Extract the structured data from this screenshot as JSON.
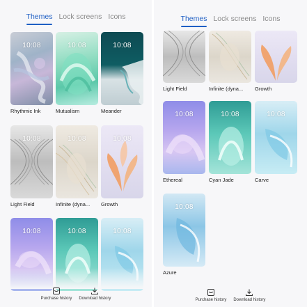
{
  "left": {
    "tabs": [
      {
        "label": "Themes",
        "active": true
      },
      {
        "label": "Lock screens",
        "active": false
      },
      {
        "label": "Icons",
        "active": false
      }
    ],
    "themes": [
      {
        "name": "Rhythmic Ink",
        "time": "10:08",
        "style": "wp-rhythmic"
      },
      {
        "name": "Mutualism",
        "time": "10:08",
        "style": "wp-mutualism"
      },
      {
        "name": "Meander",
        "time": "10:08",
        "style": "wp-meander"
      },
      {
        "name": "Light Field",
        "time": "10:08",
        "style": "wp-lightfield"
      },
      {
        "name": "Infinite (dyna...",
        "time": "10:08",
        "style": "wp-infinite"
      },
      {
        "name": "Growth",
        "time": "10:08",
        "style": "wp-growth"
      },
      {
        "name": "",
        "time": "10:08",
        "style": "wp-ethereal"
      },
      {
        "name": "",
        "time": "10:08",
        "style": "wp-cyanjade"
      },
      {
        "name": "",
        "time": "10:08",
        "style": "wp-carve"
      }
    ],
    "bottom": {
      "purchase_label": "Purchase history",
      "download_label": "Download history"
    }
  },
  "right": {
    "tabs": [
      {
        "label": "Themes",
        "active": true
      },
      {
        "label": "Lock screens",
        "active": false
      },
      {
        "label": "Icons",
        "active": false
      }
    ],
    "themes": [
      {
        "name": "Light Field",
        "time": "",
        "style": "wp-lightfield"
      },
      {
        "name": "Infinite (dyna...",
        "time": "",
        "style": "wp-infinite"
      },
      {
        "name": "Growth",
        "time": "",
        "style": "wp-growth"
      },
      {
        "name": "Ethereal",
        "time": "10:08",
        "style": "wp-ethereal"
      },
      {
        "name": "Cyan Jade",
        "time": "10:08",
        "style": "wp-cyanjade"
      },
      {
        "name": "Carve",
        "time": "10:08",
        "style": "wp-carve"
      },
      {
        "name": "Azure",
        "time": "10:08",
        "style": "wp-azure"
      }
    ],
    "bottom": {
      "purchase_label": "Purchase history",
      "download_label": "Download history"
    }
  },
  "colors": {
    "accent": "#1f5fc4",
    "tab_inactive": "#8a8a8a",
    "background": "#f7f7f9"
  },
  "icons": {
    "purchase": "purchase-history-icon",
    "download": "download-icon"
  }
}
